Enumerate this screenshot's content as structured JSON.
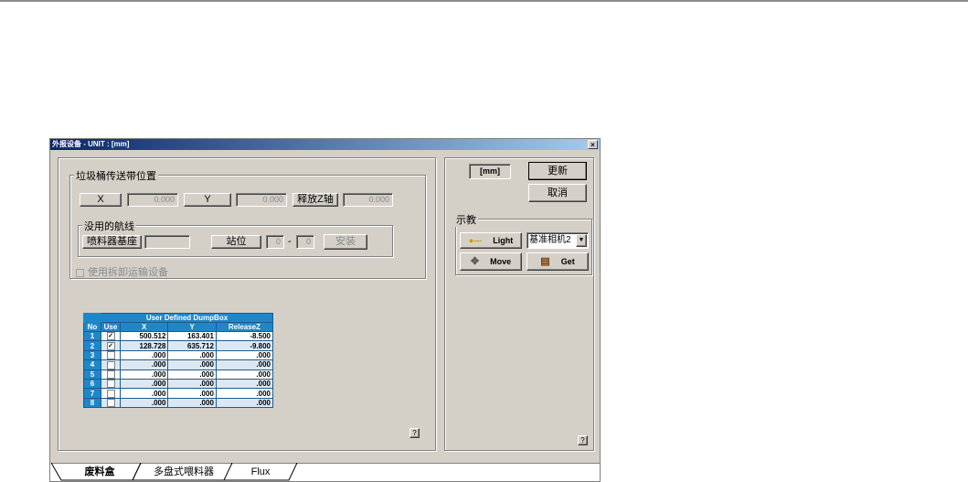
{
  "window": {
    "title": "外报设备 - UNIT : [mm]",
    "close_label": "×"
  },
  "dump_position": {
    "group_title": "垃圾桶传送带位置",
    "x_label": "X",
    "x_value": "0.000",
    "y_label": "Y",
    "y_value": "0.000",
    "release_label": "释放Z轴",
    "release_value": "0.000",
    "route_group_title": "没用的航线",
    "base_label": "喷料器基座",
    "base_value": "",
    "station_label": "站位",
    "station_from": "0",
    "station_dash": "-",
    "station_to": "0",
    "install_button": "安装",
    "use_unloader_label": "使用拆卸运输设备"
  },
  "table": {
    "title": "User Defined DumpBox",
    "columns": [
      "No",
      "Use",
      "X",
      "Y",
      "ReleaseZ"
    ],
    "rows": [
      {
        "no": "1",
        "use": "✓",
        "x": "500.512",
        "y": "163.401",
        "z": "-8.500"
      },
      {
        "no": "2",
        "use": "✓",
        "x": "128.728",
        "y": "635.712",
        "z": "-9.800"
      },
      {
        "no": "3",
        "use": "",
        "x": ".000",
        "y": ".000",
        "z": ".000"
      },
      {
        "no": "4",
        "use": "",
        "x": ".000",
        "y": ".000",
        "z": ".000"
      },
      {
        "no": "5",
        "use": "",
        "x": ".000",
        "y": ".000",
        "z": ".000"
      },
      {
        "no": "6",
        "use": "",
        "x": ".000",
        "y": ".000",
        "z": ".000"
      },
      {
        "no": "7",
        "use": "",
        "x": ".000",
        "y": ".000",
        "z": ".000"
      },
      {
        "no": "8",
        "use": "",
        "x": ".000",
        "y": ".000",
        "z": ".000"
      }
    ]
  },
  "right": {
    "unit_label": "[mm]",
    "update_button": "更新",
    "cancel_button": "取消",
    "teach_group_title": "示教",
    "light_button": "Light",
    "camera_select": "基准相机2",
    "move_button": "Move",
    "get_button": "Get"
  },
  "help_label": "?",
  "tabs": [
    "废料盒",
    "多盘式喂料器",
    "Flux"
  ],
  "colors": {
    "table_header": "#1f87c8",
    "title_bar": "#0a246a",
    "window_bg": "#d4d0c8"
  }
}
